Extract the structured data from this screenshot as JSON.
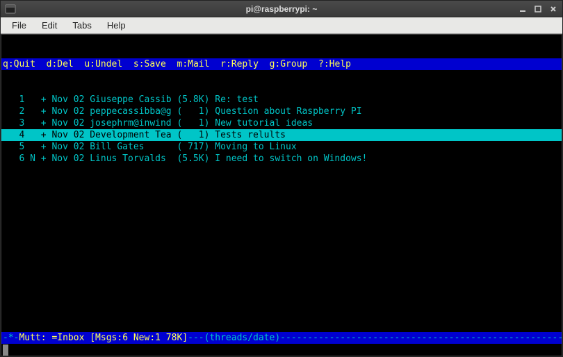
{
  "window": {
    "title": "pi@raspberrypi: ~"
  },
  "menubar": {
    "file": "File",
    "edit": "Edit",
    "tabs": "Tabs",
    "help": "Help"
  },
  "hotkeys": {
    "quit": "q:Quit",
    "del": "d:Del",
    "undel": "u:Undel",
    "save": "s:Save",
    "mail": "m:Mail",
    "reply": "r:Reply",
    "group": "g:Group",
    "help": "?:Help"
  },
  "messages": [
    {
      "line": "   1   + Nov 02 Giuseppe Cassib (5.8K) Re: test"
    },
    {
      "line": "   2   + Nov 02 peppecassibba@g (   1) Question about Raspberry PI"
    },
    {
      "line": "   3   + Nov 02 josephrm@inwind (   1) New tutorial ideas"
    },
    {
      "line": "   4   + Nov 02 Development Tea (   1) Tests relults",
      "selected": true
    },
    {
      "line": "   5   + Nov 02 Bill Gates      ( 717) Moving to Linux"
    },
    {
      "line": "   6 N + Nov 02 Linus Torvalds  (5.5K) I need to switch on Windows!"
    }
  ],
  "statusbar": {
    "prefix": "-*-",
    "mutt": "Mutt: =Inbox [Msgs:6 New:1 78K]",
    "middle": "---(threads/date)----------------------------------------------------(all)---"
  }
}
